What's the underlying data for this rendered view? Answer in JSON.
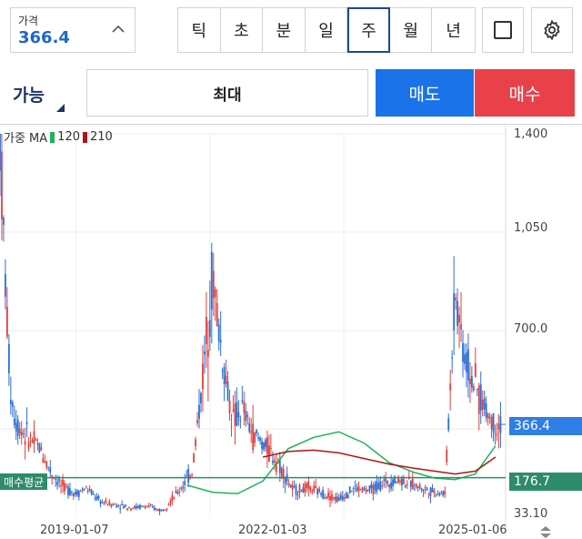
{
  "price_field": {
    "label": "가격",
    "value": "366.4"
  },
  "periods": [
    {
      "label": "틱",
      "active": false
    },
    {
      "label": "초",
      "active": false
    },
    {
      "label": "분",
      "active": false
    },
    {
      "label": "일",
      "active": false
    },
    {
      "label": "주",
      "active": true
    },
    {
      "label": "월",
      "active": false
    },
    {
      "label": "년",
      "active": false
    }
  ],
  "order": {
    "available_label": "가능",
    "quantity_label": "최대",
    "sell_label": "매도",
    "buy_label": "매수"
  },
  "legend": {
    "prefix": "가중 MA",
    "ma1": "120",
    "ma2": "210",
    "ma1_color": "#1db35b",
    "ma2_color": "#b01515"
  },
  "y_axis": {
    "ticks": [
      "1,400",
      "1,050",
      "700.0",
      "33.10"
    ]
  },
  "current_price_tag": {
    "value": "366.4",
    "color": "#2f7ee6"
  },
  "avg_buy": {
    "label": "매수평균",
    "value": "176.7",
    "color": "#2e8b6a"
  },
  "x_axis": {
    "ticks": [
      "2019-01-07",
      "2022-01-03",
      "2025-01-06"
    ]
  },
  "chart_data": {
    "type": "candlestick",
    "title": "",
    "xlabel": "",
    "ylabel": "",
    "ylim": [
      33.1,
      1400
    ],
    "x_ticks": [
      "2019-01-07",
      "2022-01-03",
      "2025-01-06"
    ],
    "current_price": 366.4,
    "avg_buy_price": 176.7,
    "series": [
      {
        "name": "120",
        "color": "#1db35b",
        "x": [
          0.37,
          0.42,
          0.47,
          0.52,
          0.57,
          0.62,
          0.67,
          0.72,
          0.77,
          0.82,
          0.86,
          0.9,
          0.94,
          0.98
        ],
        "values": [
          150,
          125,
          120,
          165,
          280,
          320,
          340,
          300,
          230,
          195,
          175,
          170,
          190,
          290
        ]
      },
      {
        "name": "210",
        "color": "#b01515",
        "x": [
          0.52,
          0.57,
          0.62,
          0.67,
          0.72,
          0.77,
          0.82,
          0.86,
          0.9,
          0.94,
          0.98
        ],
        "values": [
          250,
          270,
          275,
          265,
          245,
          225,
          210,
          200,
          190,
          200,
          250
        ]
      }
    ],
    "price_path": {
      "x": [
        0.0,
        0.01,
        0.02,
        0.03,
        0.05,
        0.08,
        0.1,
        0.12,
        0.15,
        0.17,
        0.2,
        0.23,
        0.26,
        0.29,
        0.32,
        0.35,
        0.38,
        0.4,
        0.42,
        0.44,
        0.46,
        0.48,
        0.5,
        0.52,
        0.55,
        0.58,
        0.61,
        0.64,
        0.67,
        0.7,
        0.73,
        0.76,
        0.79,
        0.82,
        0.85,
        0.88,
        0.9,
        0.92,
        0.94,
        0.96,
        0.98,
        0.99
      ],
      "values": [
        1400,
        900,
        500,
        380,
        330,
        280,
        200,
        150,
        120,
        140,
        90,
        80,
        70,
        75,
        60,
        120,
        200,
        520,
        900,
        600,
        380,
        420,
        330,
        300,
        230,
        130,
        140,
        120,
        100,
        140,
        130,
        160,
        170,
        150,
        130,
        120,
        850,
        600,
        500,
        420,
        360,
        366
      ]
    }
  }
}
